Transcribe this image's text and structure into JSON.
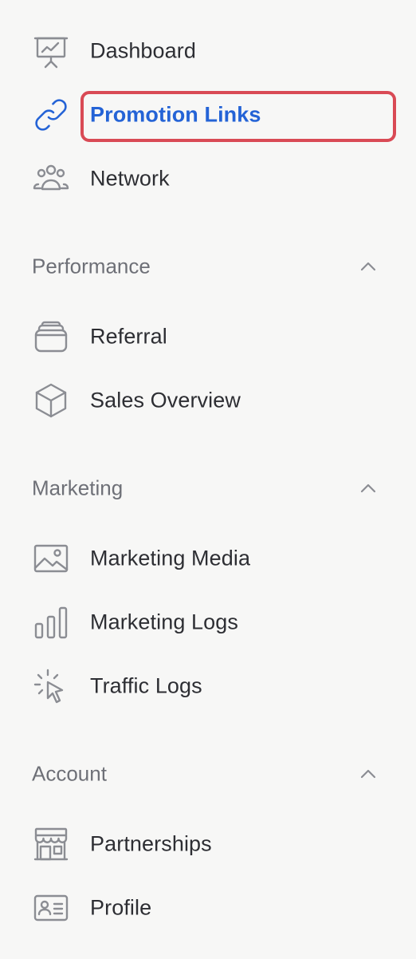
{
  "sidebar": {
    "top_items": [
      {
        "label": "Dashboard",
        "icon": "presentation-chart-icon"
      },
      {
        "label": "Promotion Links",
        "icon": "link-icon",
        "active": true
      },
      {
        "label": "Network",
        "icon": "users-group-icon"
      }
    ],
    "sections": [
      {
        "title": "Performance",
        "expanded": true,
        "items": [
          {
            "label": "Referral",
            "icon": "stack-icon"
          },
          {
            "label": "Sales Overview",
            "icon": "cube-icon"
          }
        ]
      },
      {
        "title": "Marketing",
        "expanded": true,
        "items": [
          {
            "label": "Marketing Media",
            "icon": "image-icon"
          },
          {
            "label": "Marketing Logs",
            "icon": "bar-chart-icon"
          },
          {
            "label": "Traffic Logs",
            "icon": "cursor-click-icon"
          }
        ]
      },
      {
        "title": "Account",
        "expanded": true,
        "items": [
          {
            "label": "Partnerships",
            "icon": "storefront-icon"
          },
          {
            "label": "Profile",
            "icon": "id-card-icon"
          }
        ]
      }
    ]
  },
  "colors": {
    "background": "#f7f7f6",
    "text": "#2d2e33",
    "section_text": "#6e7077",
    "icon": "#8b8d93",
    "active": "#2463d6",
    "highlight": "#d94a55"
  }
}
